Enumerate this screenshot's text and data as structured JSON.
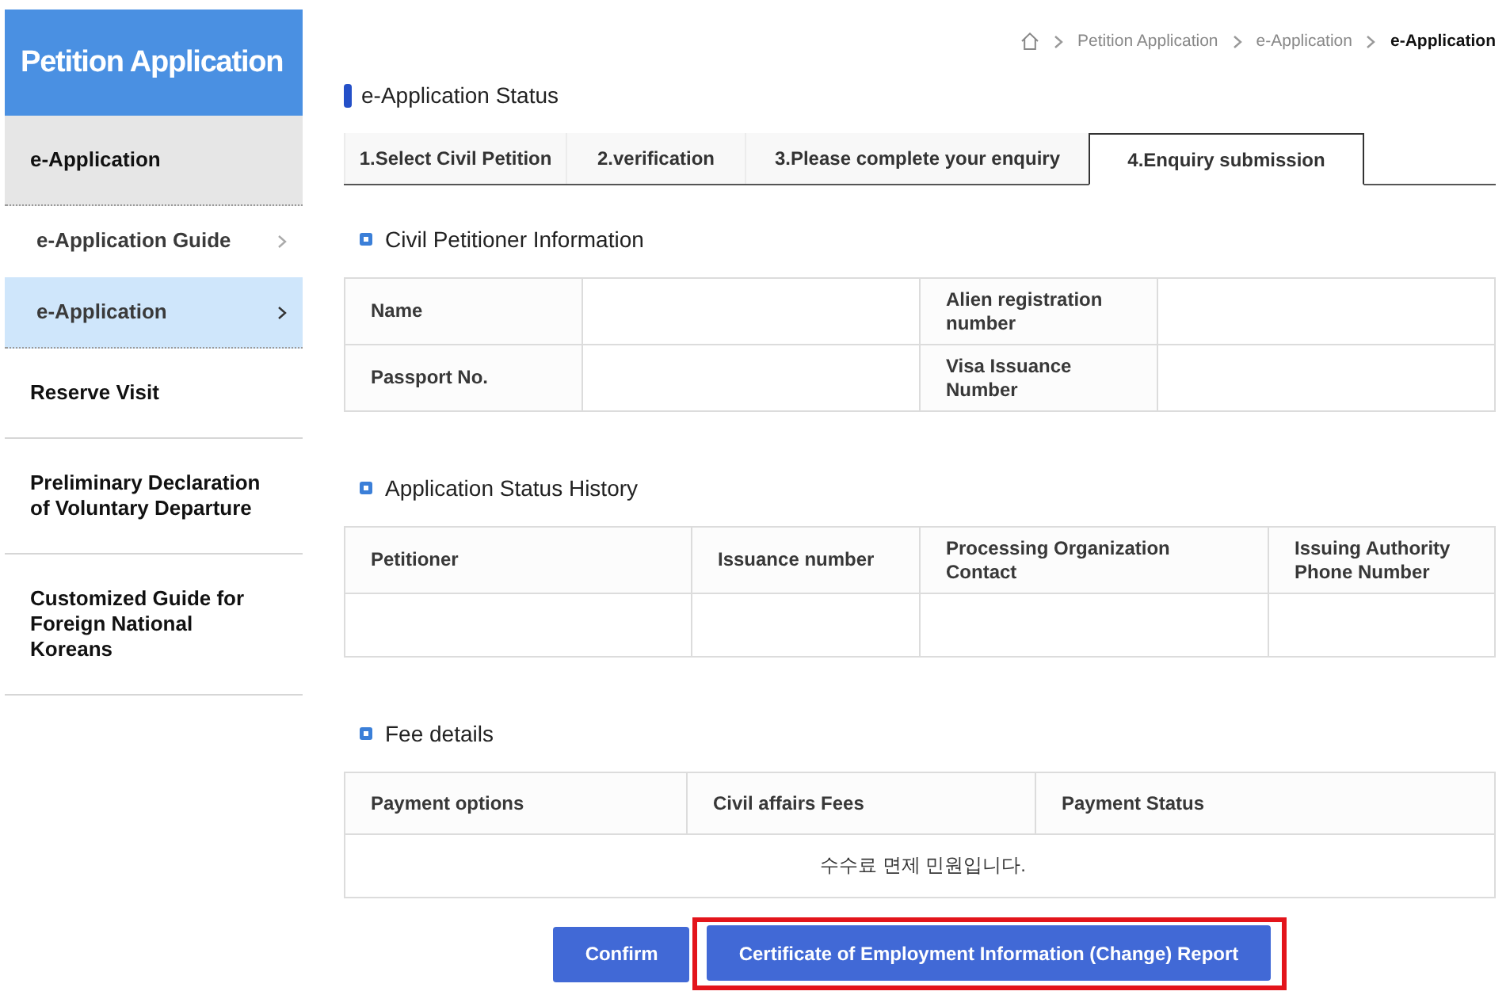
{
  "sidebar": {
    "title": "Petition Application",
    "menu": [
      {
        "label": "e-Application",
        "expanded": true,
        "children": [
          {
            "label": "e-Application Guide",
            "selected": false
          },
          {
            "label": "e-Application",
            "selected": true
          }
        ]
      },
      {
        "label": "Reserve Visit",
        "expanded": false
      },
      {
        "label": "Preliminary Declaration of Voluntary Departure",
        "expanded": false
      },
      {
        "label": "Customized Guide for Foreign National Koreans",
        "expanded": false
      }
    ]
  },
  "breadcrumb": [
    {
      "label": "Petition Application",
      "current": false
    },
    {
      "label": "e-Application",
      "current": false
    },
    {
      "label": "e-Application",
      "current": true
    }
  ],
  "page_title": "e-Application Status",
  "tabs": [
    {
      "label": "1.Select Civil Petition",
      "selected": false
    },
    {
      "label": "2.verification",
      "selected": false
    },
    {
      "label": "3.Please complete your enquiry",
      "selected": false
    },
    {
      "label": "4.Enquiry submission",
      "selected": true
    }
  ],
  "sections": [
    {
      "kind": "form",
      "title": "Civil Petitioner Information",
      "rows": [
        [
          "Name",
          "Alien registration number"
        ],
        [
          "Passport No.",
          "Visa Issuance Number"
        ]
      ]
    },
    {
      "kind": "table",
      "title": "Application Status History",
      "columns": [
        "Petitioner",
        "Issuance number",
        "Processing Organization Contact",
        "Issuing Authority Phone Number"
      ]
    },
    {
      "kind": "table",
      "title": "Fee details",
      "columns": [
        "Payment options",
        "Civil affairs Fees",
        "Payment Status"
      ],
      "notice": "수수료 면제 민원입니다."
    }
  ],
  "buttons": [
    {
      "label": "Confirm",
      "highlighted": false
    },
    {
      "label": "Certificate of Employment Information (Change) Report",
      "highlighted": true
    }
  ]
}
